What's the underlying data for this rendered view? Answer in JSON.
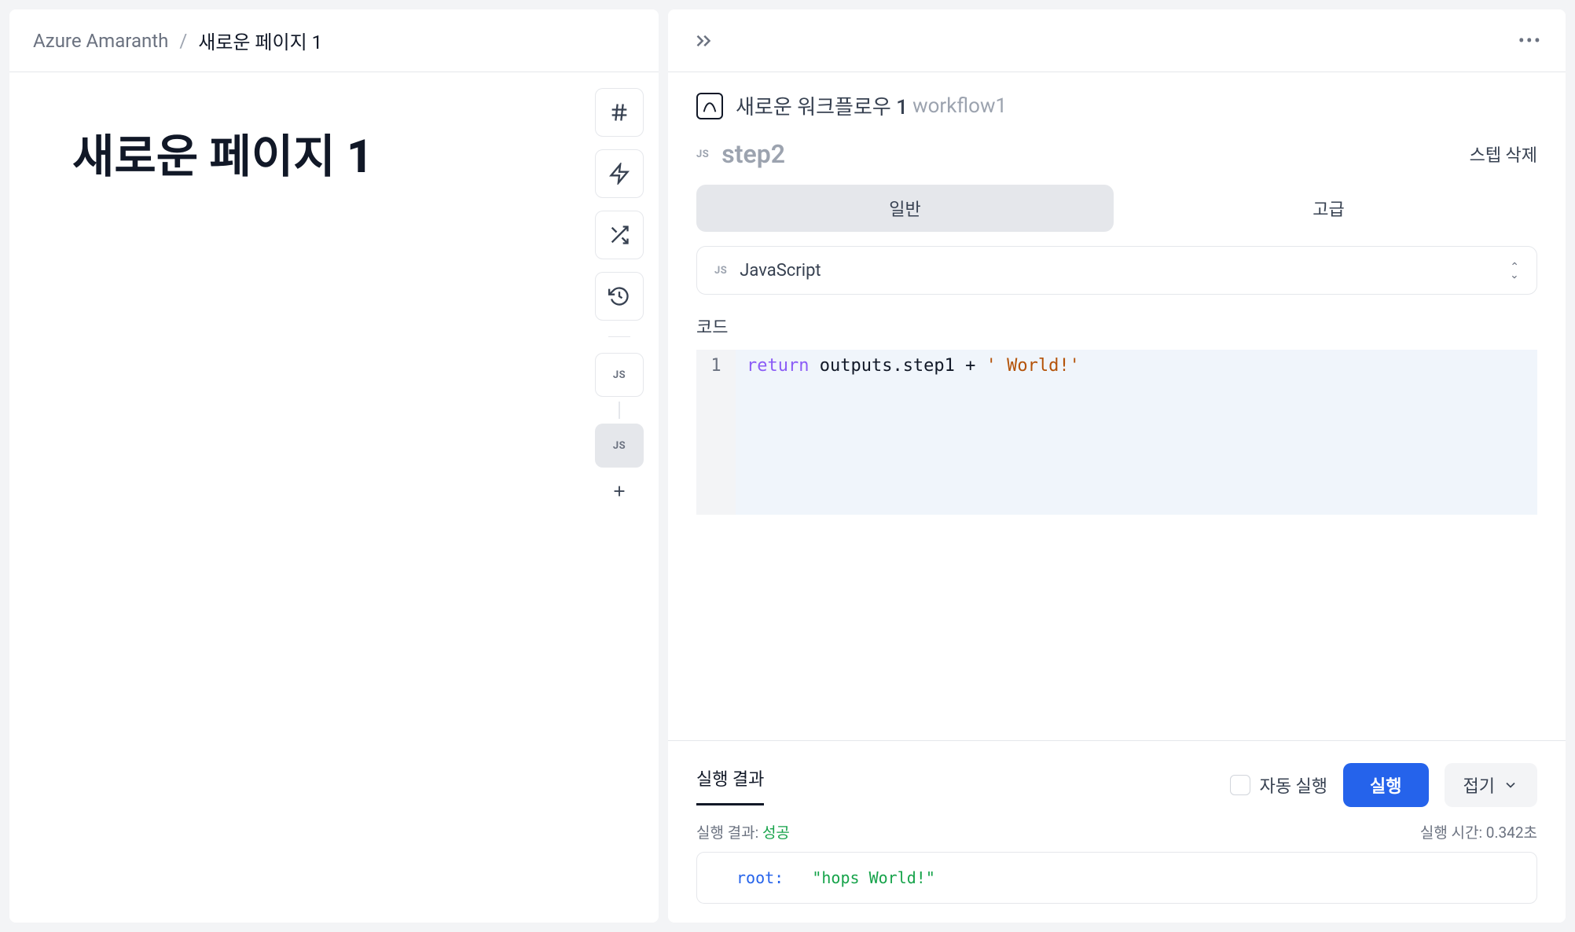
{
  "breadcrumb": {
    "root": "Azure Amaranth",
    "separator": "/",
    "current": "새로운 페이지 1"
  },
  "page": {
    "title": "새로운 페이지 1"
  },
  "rail": {
    "node1": "JS",
    "node2": "JS"
  },
  "workflow": {
    "title": "새로운 워크플로우 1",
    "id": "workflow1"
  },
  "step": {
    "badge": "JS",
    "name": "step2",
    "delete_label": "스텝 삭제"
  },
  "tabs": {
    "general": "일반",
    "advanced": "고급"
  },
  "language": {
    "badge": "JS",
    "selected": "JavaScript"
  },
  "code": {
    "label": "코드",
    "line_number": "1",
    "tokens": {
      "kw": "return",
      "ident": " outputs.step1 ",
      "op": "+",
      "str": " ' World!'"
    }
  },
  "results": {
    "tab_label": "실행 결과",
    "auto_run": "자동 실행",
    "run_btn": "실행",
    "fold_btn": "접기",
    "status_label": "실행 결과: ",
    "status_value": "성공",
    "time_label": "실행 시간: ",
    "time_value": "0.342초",
    "output_key": "root:",
    "output_value": "\"hops World!\""
  }
}
